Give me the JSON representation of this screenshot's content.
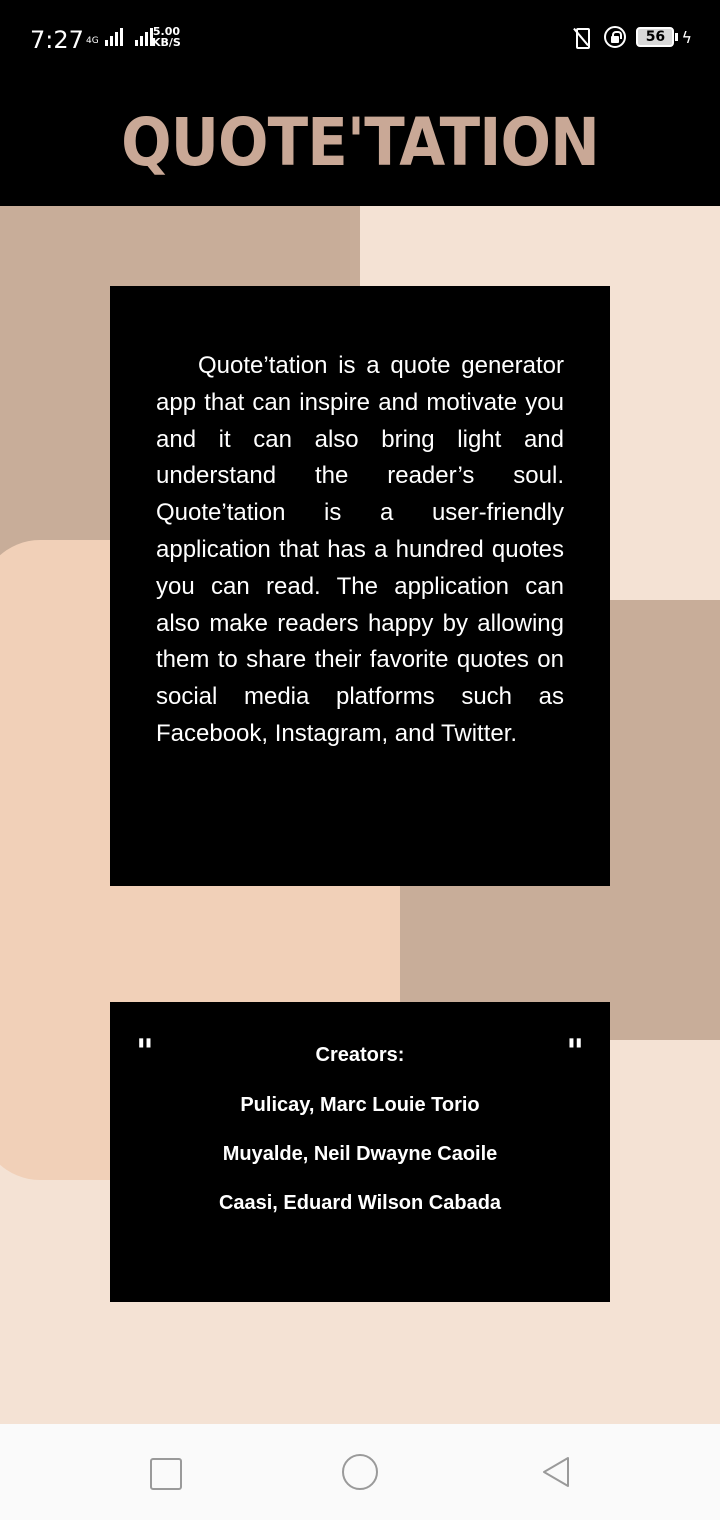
{
  "status_bar": {
    "time": "7:27",
    "network": "4G",
    "speed_value": "5.00",
    "speed_unit": "KB/S",
    "battery": "56"
  },
  "header": {
    "title": "QUOTE'TATION"
  },
  "about": {
    "text": "Quote’tation is a quote generator app that can inspire and motivate you and it can also bring light and understand the reader’s soul. Quote’tation is a user-friendly application that has a hundred quotes you can read. The application can also make readers happy by allowing them to share their favorite quotes on social media platforms such as Facebook, Instagram, and Twitter."
  },
  "creators": {
    "open_quote": "\"",
    "close_quote": "\"",
    "title": "Creators:",
    "names": [
      "Pulicay, Marc Louie Torio",
      "Muyalde, Neil Dwayne Caoile",
      "Caasi, Eduard Wilson Cabada"
    ]
  },
  "colors": {
    "header_bg": "#000000",
    "title_color": "#c9a896",
    "page_bg": "#f4e2d4",
    "card_bg": "#000000"
  },
  "nav_icons": [
    "recent-apps-icon",
    "home-icon",
    "back-icon"
  ]
}
